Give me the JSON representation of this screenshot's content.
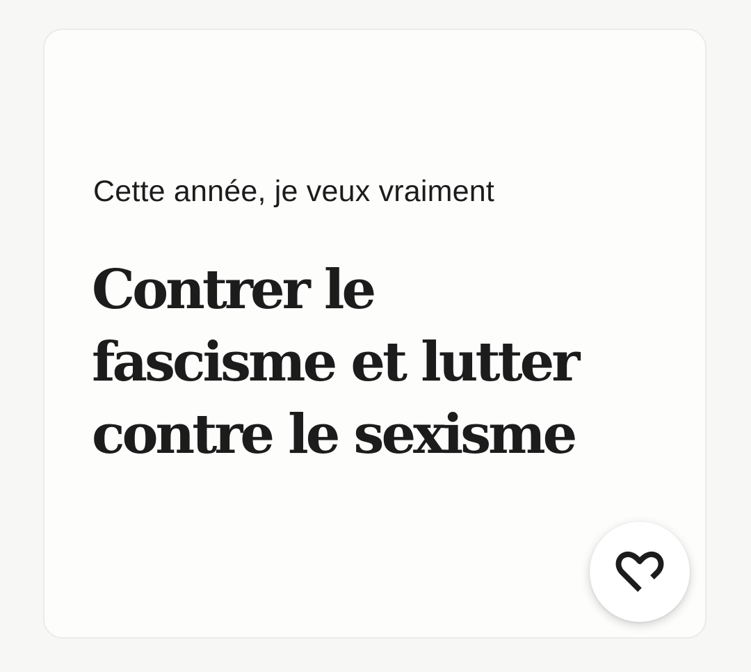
{
  "card": {
    "prompt_label": "Cette année, je veux vraiment",
    "answer_lines": [
      "Contrer le",
      "fascisme et lutter",
      "contre le sexisme"
    ],
    "like_icon": "heart-outline-icon"
  },
  "colors": {
    "background": "#f7f7f6",
    "card_background": "#fdfdfc",
    "text": "#1c1c1c"
  }
}
